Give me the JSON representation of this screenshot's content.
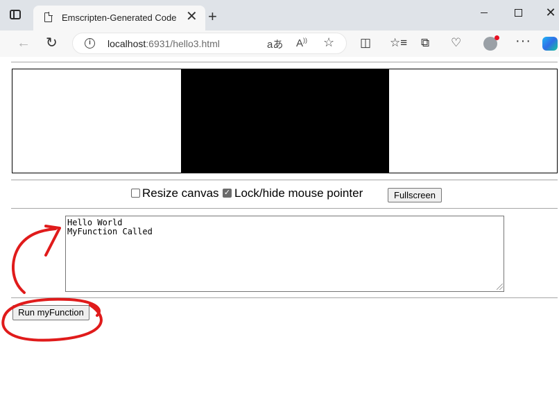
{
  "browser": {
    "tab_title": "Emscripten-Generated Code",
    "tab_close": "✕",
    "new_tab": "+",
    "url_host": "localhost",
    "url_rest": ":6931/hello3.html",
    "translate_icon": "aあ",
    "read_aloud_icon": "Aͅ",
    "more": "···",
    "icons": [
      "sidebar-toggle-icon",
      "page-icon",
      "back-arrow-icon",
      "reload-icon",
      "info-icon",
      "translate-icon",
      "read-aloud-icon",
      "favorite-star-icon",
      "split-screen-icon",
      "favorites-icon",
      "collections-icon",
      "browser-essentials-icon",
      "profile-avatar-icon",
      "more-icon",
      "copilot-icon"
    ],
    "avatar_notification_color": "#e81123"
  },
  "page": {
    "controls": {
      "resize_label": "Resize canvas",
      "resize_checked": false,
      "lock_label": "Lock/hide mouse pointer",
      "lock_checked": true,
      "fullscreen_button": "Fullscreen"
    },
    "output": {
      "text": "Hello World\nMyFunction Called"
    },
    "run_button": "Run myFunction"
  },
  "annotation": {
    "color": "#e01b1b",
    "shapes": [
      "circle-around-run-button",
      "arrow-to-output"
    ]
  }
}
